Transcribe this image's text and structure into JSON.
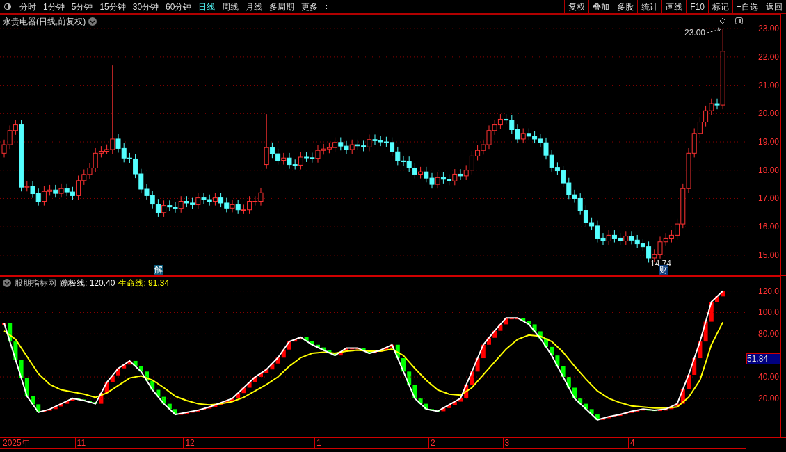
{
  "toolbar": {
    "periods": [
      {
        "label": "分时",
        "selected": false
      },
      {
        "label": "1分钟",
        "selected": false
      },
      {
        "label": "5分钟",
        "selected": false
      },
      {
        "label": "15分钟",
        "selected": false
      },
      {
        "label": "30分钟",
        "selected": false
      },
      {
        "label": "60分钟",
        "selected": false
      },
      {
        "label": "日线",
        "selected": true
      },
      {
        "label": "周线",
        "selected": false
      },
      {
        "label": "月线",
        "selected": false
      },
      {
        "label": "多周期",
        "selected": false
      },
      {
        "label": "更多",
        "selected": false
      }
    ],
    "actions": [
      "复权",
      "叠加",
      "多股",
      "统计",
      "画线",
      "F10",
      "标记",
      "+自选",
      "返回"
    ]
  },
  "main_chart": {
    "title": "永贵电器(日线,前复权)",
    "high_label": "23.00",
    "low_label": "14.74",
    "markers": [
      "解",
      "财"
    ],
    "chart_data": {
      "type": "candlestick",
      "ylim": [
        14.26,
        23.52
      ],
      "grid": true,
      "yticks": [
        {
          "value": 23,
          "label": "23.00"
        },
        {
          "value": 22,
          "label": "22.00"
        },
        {
          "value": 21,
          "label": "21.00"
        },
        {
          "value": 20,
          "label": "20.00"
        },
        {
          "value": 19,
          "label": "19.00"
        },
        {
          "value": 18,
          "label": "18.00"
        },
        {
          "value": 17,
          "label": "17.00"
        },
        {
          "value": 16,
          "label": "16.00"
        },
        {
          "value": 15,
          "label": "15.00"
        }
      ],
      "ohlc": [
        [
          18.6,
          19.08,
          18.45,
          18.9
        ],
        [
          18.9,
          19.58,
          18.75,
          19.4
        ],
        [
          19.4,
          19.78,
          19.25,
          19.6
        ],
        [
          19.6,
          19.78,
          17.25,
          17.4
        ],
        [
          17.4,
          17.61,
          17.25,
          17.43
        ],
        [
          17.43,
          17.61,
          17.02,
          17.17
        ],
        [
          17.17,
          17.35,
          16.75,
          16.9
        ],
        [
          16.9,
          17.43,
          16.75,
          17.25
        ],
        [
          17.25,
          17.48,
          17.1,
          17.3
        ],
        [
          17.3,
          17.48,
          17.03,
          17.18
        ],
        [
          17.18,
          17.53,
          17.03,
          17.35
        ],
        [
          17.35,
          17.53,
          17.08,
          17.23
        ],
        [
          17.23,
          17.41,
          16.95,
          17.1
        ],
        [
          17.1,
          17.81,
          16.95,
          17.63
        ],
        [
          17.63,
          18.03,
          17.48,
          17.85
        ],
        [
          17.85,
          18.26,
          17.7,
          18.08
        ],
        [
          18.08,
          18.78,
          17.93,
          18.6
        ],
        [
          18.6,
          18.85,
          18.45,
          18.67
        ],
        [
          18.67,
          18.91,
          18.58,
          18.73
        ],
        [
          18.73,
          21.7,
          18.58,
          19.1
        ],
        [
          19.1,
          19.28,
          18.62,
          18.77
        ],
        [
          18.77,
          18.95,
          18.28,
          18.43
        ],
        [
          18.43,
          18.61,
          18.25,
          18.4
        ],
        [
          18.4,
          18.58,
          17.72,
          17.87
        ],
        [
          17.87,
          18.05,
          17.18,
          17.33
        ],
        [
          17.33,
          17.51,
          16.95,
          17.1
        ],
        [
          17.1,
          17.28,
          16.65,
          16.8
        ],
        [
          16.8,
          16.98,
          16.35,
          16.5
        ],
        [
          16.5,
          16.93,
          16.35,
          16.75
        ],
        [
          16.75,
          16.93,
          16.55,
          16.7
        ],
        [
          16.7,
          16.88,
          16.5,
          16.65
        ],
        [
          16.65,
          17.08,
          16.5,
          16.9
        ],
        [
          16.9,
          17.08,
          16.69,
          16.84
        ],
        [
          16.84,
          17.02,
          16.63,
          16.78
        ],
        [
          16.78,
          17.2,
          16.63,
          17.02
        ],
        [
          17.02,
          17.2,
          16.81,
          16.96
        ],
        [
          16.96,
          17.14,
          16.75,
          16.9
        ],
        [
          16.9,
          17.2,
          16.75,
          17.02
        ],
        [
          17.02,
          17.2,
          16.69,
          16.84
        ],
        [
          16.84,
          17.02,
          16.51,
          16.66
        ],
        [
          16.66,
          16.96,
          16.51,
          16.78
        ],
        [
          16.78,
          16.96,
          16.45,
          16.6
        ],
        [
          16.6,
          16.78,
          16.45,
          16.6
        ],
        [
          16.6,
          17.08,
          16.45,
          16.9
        ],
        [
          16.9,
          17.08,
          16.75,
          16.9
        ],
        [
          16.9,
          17.38,
          16.75,
          17.2
        ],
        [
          18.2,
          19.98,
          18.05,
          18.8
        ],
        [
          18.8,
          18.98,
          18.43,
          18.58
        ],
        [
          18.58,
          18.76,
          18.2,
          18.35
        ],
        [
          18.35,
          18.61,
          18.2,
          18.43
        ],
        [
          18.43,
          18.61,
          18.05,
          18.2
        ],
        [
          18.2,
          18.38,
          18.03,
          18.18
        ],
        [
          18.18,
          18.64,
          18.03,
          18.46
        ],
        [
          18.46,
          18.64,
          18.29,
          18.44
        ],
        [
          18.44,
          18.62,
          18.27,
          18.42
        ],
        [
          18.42,
          18.88,
          18.27,
          18.7
        ],
        [
          18.7,
          18.93,
          18.55,
          18.75
        ],
        [
          18.75,
          18.98,
          18.6,
          18.8
        ],
        [
          18.8,
          19.16,
          18.65,
          18.98
        ],
        [
          18.98,
          19.16,
          18.7,
          18.85
        ],
        [
          18.85,
          19.03,
          18.58,
          18.73
        ],
        [
          18.73,
          19.08,
          18.58,
          18.9
        ],
        [
          18.9,
          19.08,
          18.71,
          18.86
        ],
        [
          18.86,
          19.04,
          18.67,
          18.82
        ],
        [
          18.82,
          19.26,
          18.67,
          19.08
        ],
        [
          19.08,
          19.26,
          18.89,
          19.04
        ],
        [
          19.04,
          19.22,
          18.85,
          19.0
        ],
        [
          19.0,
          19.18,
          18.83,
          18.98
        ],
        [
          18.98,
          19.16,
          18.5,
          18.65
        ],
        [
          18.65,
          18.83,
          18.18,
          18.33
        ],
        [
          18.33,
          18.51,
          18.15,
          18.3
        ],
        [
          18.3,
          18.48,
          17.93,
          18.08
        ],
        [
          18.08,
          18.26,
          17.71,
          17.86
        ],
        [
          17.86,
          18.12,
          17.71,
          17.94
        ],
        [
          17.94,
          18.12,
          17.57,
          17.72
        ],
        [
          17.72,
          17.9,
          17.35,
          17.5
        ],
        [
          17.5,
          17.92,
          17.35,
          17.74
        ],
        [
          17.74,
          17.92,
          17.53,
          17.68
        ],
        [
          17.68,
          17.86,
          17.47,
          17.62
        ],
        [
          17.62,
          18.04,
          17.47,
          17.86
        ],
        [
          17.86,
          18.04,
          17.65,
          17.8
        ],
        [
          17.8,
          18.18,
          17.65,
          18.0
        ],
        [
          18.0,
          18.68,
          17.85,
          18.5
        ],
        [
          18.5,
          18.88,
          18.35,
          18.7
        ],
        [
          18.7,
          19.08,
          18.55,
          18.9
        ],
        [
          18.9,
          19.58,
          18.75,
          19.4
        ],
        [
          19.4,
          19.78,
          19.25,
          19.6
        ],
        [
          19.6,
          19.98,
          19.45,
          19.8
        ],
        [
          19.8,
          19.98,
          19.62,
          19.77
        ],
        [
          19.77,
          19.95,
          19.28,
          19.43
        ],
        [
          19.43,
          19.61,
          18.95,
          19.1
        ],
        [
          19.1,
          19.48,
          18.95,
          19.3
        ],
        [
          19.3,
          19.48,
          19.05,
          19.2
        ],
        [
          19.2,
          19.38,
          18.95,
          19.1
        ],
        [
          19.1,
          19.28,
          18.82,
          18.97
        ],
        [
          18.97,
          19.15,
          18.38,
          18.53
        ],
        [
          18.53,
          18.71,
          17.95,
          18.1
        ],
        [
          18.1,
          18.28,
          17.83,
          17.98
        ],
        [
          17.98,
          18.16,
          17.4,
          17.55
        ],
        [
          17.55,
          17.73,
          16.98,
          17.13
        ],
        [
          17.13,
          17.31,
          16.85,
          17.0
        ],
        [
          17.0,
          17.18,
          16.43,
          16.58
        ],
        [
          16.58,
          16.76,
          16.0,
          16.15
        ],
        [
          16.15,
          16.33,
          15.88,
          16.03
        ],
        [
          16.03,
          16.21,
          15.45,
          15.6
        ],
        [
          15.6,
          15.78,
          15.35,
          15.5
        ],
        [
          15.5,
          15.88,
          15.35,
          15.7
        ],
        [
          15.7,
          15.88,
          15.45,
          15.6
        ],
        [
          15.6,
          15.78,
          15.35,
          15.5
        ],
        [
          15.5,
          15.85,
          15.35,
          15.67
        ],
        [
          15.67,
          15.85,
          15.38,
          15.53
        ],
        [
          15.53,
          15.71,
          15.25,
          15.4
        ],
        [
          15.4,
          15.58,
          15.15,
          15.3
        ],
        [
          15.3,
          15.48,
          14.74,
          14.9
        ],
        [
          14.9,
          15.21,
          14.75,
          15.03
        ],
        [
          15.03,
          15.65,
          14.88,
          15.47
        ],
        [
          15.47,
          15.78,
          15.32,
          15.6
        ],
        [
          15.6,
          15.88,
          15.45,
          15.7
        ],
        [
          15.7,
          16.28,
          15.55,
          16.1
        ],
        [
          16.1,
          17.53,
          15.95,
          17.35
        ],
        [
          17.35,
          18.78,
          17.2,
          18.6
        ],
        [
          18.6,
          19.48,
          18.45,
          19.3
        ],
        [
          19.3,
          19.88,
          19.15,
          19.7
        ],
        [
          19.7,
          20.28,
          19.55,
          20.1
        ],
        [
          20.1,
          20.53,
          19.95,
          20.35
        ],
        [
          20.35,
          20.53,
          20.15,
          20.3
        ],
        [
          20.3,
          23.0,
          20.15,
          22.2
        ]
      ]
    }
  },
  "indicator": {
    "name": "股朋指标网",
    "legend_values": [
      "120.40",
      "91.34"
    ],
    "cursor_value": "51.84",
    "chart_data": {
      "type": "line",
      "ylim": [
        -17,
        134
      ],
      "grid": true,
      "yticks": [
        {
          "value": 120,
          "label": "120.0"
        },
        {
          "value": 100,
          "label": "100.0"
        },
        {
          "value": 80,
          "label": "80.00"
        },
        {
          "value": 40,
          "label": "40.00"
        },
        {
          "value": 20,
          "label": "20.00"
        }
      ],
      "series": [
        {
          "name": "蹦极线:",
          "color": "#ffffff",
          "values": [
            90,
            56,
            22,
            7,
            10,
            15,
            20,
            18,
            15,
            35,
            48,
            55,
            45,
            28,
            15,
            5,
            7,
            9,
            12,
            16,
            20,
            30,
            40,
            47,
            58,
            73,
            77,
            70,
            65,
            60,
            67,
            67,
            62,
            65,
            70,
            45,
            20,
            10,
            8,
            14,
            20,
            45,
            70,
            83,
            95,
            95,
            89,
            76,
            60,
            40,
            20,
            10,
            0,
            3,
            5,
            8,
            10,
            9,
            10,
            15,
            42,
            73,
            110,
            120
          ]
        },
        {
          "name": "生命线:",
          "color": "#ffff00",
          "values": [
            83,
            75,
            59,
            43,
            33,
            28,
            26,
            24,
            21,
            25,
            32,
            39,
            41,
            37,
            30,
            22,
            18,
            15,
            14,
            15,
            17,
            21,
            27,
            33,
            40,
            50,
            58,
            62,
            63,
            62,
            64,
            65,
            64,
            64,
            66,
            60,
            48,
            37,
            28,
            24,
            23,
            30,
            42,
            54,
            66,
            75,
            79,
            78,
            73,
            63,
            50,
            38,
            27,
            20,
            16,
            13,
            12,
            11,
            11,
            12,
            21,
            37,
            70,
            91
          ]
        }
      ]
    }
  },
  "date_axis": [
    "2025年",
    "11",
    "12",
    "1",
    "2",
    "3",
    "4"
  ]
}
